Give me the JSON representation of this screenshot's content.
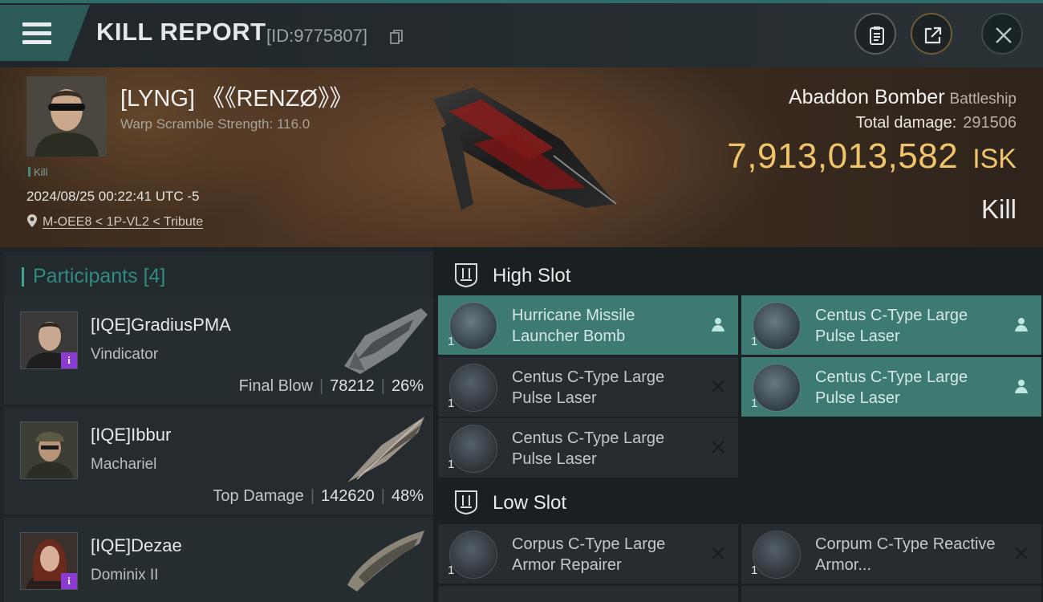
{
  "header": {
    "title": "KILL REPORT",
    "kill_id": "[ID:9775807]"
  },
  "victim": {
    "name": "[LYNG] 《《RENZØ》》",
    "warp_scramble": "Warp Scramble Strength: 116.0",
    "type_tag": "Kill",
    "datetime": "2024/08/25 00:22:41 UTC -5",
    "location": "M-OEE8 < 1P-VL2 < Tribute",
    "ship_name": "Abaddon Bomber",
    "ship_class": "Battleship",
    "total_damage_label": "Total damage:",
    "total_damage": "291506",
    "isk_value": "7,913,013,582",
    "isk_unit": "ISK",
    "result": "Kill"
  },
  "participants": {
    "label": "Participants",
    "count": "[4]",
    "rows": [
      {
        "name": "[IQE]GradiusPMA",
        "ship": "Vindicator",
        "role": "Final Blow",
        "damage": "78212",
        "percent": "26%",
        "badge": "i"
      },
      {
        "name": "[IQE]Ibbur",
        "ship": "Machariel",
        "role": "Top Damage",
        "damage": "142620",
        "percent": "48%",
        "badge": ""
      },
      {
        "name": "[IQE]Dezae",
        "ship": "Dominix II",
        "role": "",
        "damage": "",
        "percent": "",
        "badge": "i"
      }
    ]
  },
  "fitting": {
    "high_slot_label": "High Slot",
    "low_slot_label": "Low Slot",
    "high": [
      {
        "name": "Hurricane Missile Launcher Bomb",
        "qty": "1",
        "status": "dropped",
        "icon": "missile-launcher-icon"
      },
      {
        "name": "Centus C-Type Large Pulse Laser",
        "qty": "1",
        "status": "dropped",
        "icon": "pulse-laser-icon"
      },
      {
        "name": "Centus C-Type Large Pulse Laser",
        "qty": "1",
        "status": "destroyed",
        "icon": "pulse-laser-icon"
      },
      {
        "name": "Centus C-Type Large Pulse Laser",
        "qty": "1",
        "status": "dropped",
        "icon": "pulse-laser-icon"
      },
      {
        "name": "Centus C-Type Large Pulse Laser",
        "qty": "1",
        "status": "destroyed",
        "icon": "pulse-laser-icon"
      }
    ],
    "low": [
      {
        "name": "Corpus C-Type Large Armor Repairer",
        "qty": "1",
        "status": "destroyed",
        "icon": "armor-repairer-icon"
      },
      {
        "name": "Corpum C-Type Reactive Armor...",
        "qty": "1",
        "status": "destroyed",
        "icon": "reactive-armor-icon"
      }
    ]
  },
  "colors": {
    "accent_teal": "#3c7a72",
    "isk_gold": "#f0c46a",
    "badge_purple": "#8b3bd1"
  }
}
